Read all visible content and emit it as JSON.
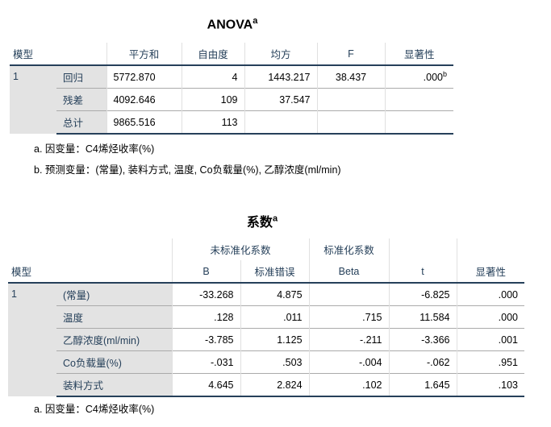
{
  "anova": {
    "title": "ANOVA",
    "title_sup": "a",
    "headers": [
      "模型",
      "平方和",
      "自由度",
      "均方",
      "F",
      "显著性"
    ],
    "model": "1",
    "rows": [
      {
        "label": "回归",
        "ss": "5772.870",
        "df": "4",
        "ms": "1443.217",
        "f": "38.437",
        "sig": ".000",
        "sig_sup": "b"
      },
      {
        "label": "残差",
        "ss": "4092.646",
        "df": "109",
        "ms": "37.547",
        "f": "",
        "sig": ""
      },
      {
        "label": "总计",
        "ss": "9865.516",
        "df": "113",
        "ms": "",
        "f": "",
        "sig": ""
      }
    ],
    "footnotes": [
      "a. 因变量：C4烯烃收率(%)",
      "b. 预测变量：(常量), 装料方式, 温度, Co负载量(%), 乙醇浓度(ml/min)"
    ]
  },
  "coef": {
    "title": "系数",
    "title_sup": "a",
    "group_headers": [
      "未标准化系数",
      "标准化系数"
    ],
    "headers": [
      "模型",
      "B",
      "标准错误",
      "Beta",
      "t",
      "显著性"
    ],
    "model": "1",
    "rows": [
      {
        "label": "(常量)",
        "b": "-33.268",
        "se": "4.875",
        "beta": "",
        "t": "-6.825",
        "sig": ".000"
      },
      {
        "label": "温度",
        "b": ".128",
        "se": ".011",
        "beta": ".715",
        "t": "11.584",
        "sig": ".000"
      },
      {
        "label": "乙醇浓度(ml/min)",
        "b": "-3.785",
        "se": "1.125",
        "beta": "-.211",
        "t": "-3.366",
        "sig": ".001"
      },
      {
        "label": "Co负载量(%)",
        "b": "-.031",
        "se": ".503",
        "beta": "-.004",
        "t": "-.062",
        "sig": ".951"
      },
      {
        "label": "装料方式",
        "b": "4.645",
        "se": "2.824",
        "beta": ".102",
        "t": "1.645",
        "sig": ".103"
      }
    ],
    "footnotes": [
      "a. 因变量：C4烯烃收率(%)"
    ]
  }
}
